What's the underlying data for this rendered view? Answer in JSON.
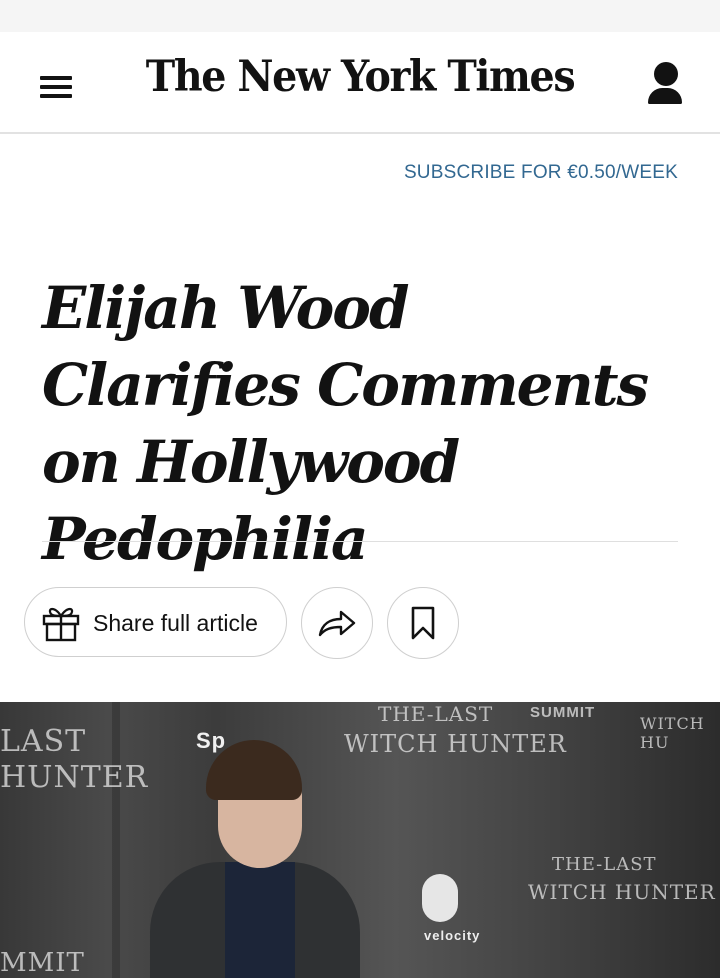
{
  "masthead": {
    "logo_text": "The New York Times",
    "menu_icon": "hamburger-menu-icon",
    "account_icon": "user-account-icon"
  },
  "subscribe": {
    "label": "SUBSCRIBE FOR €0.50/WEEK",
    "color": "#326891"
  },
  "article": {
    "headline": "Elijah Wood Clarifies Comments on Hollywood Pedophilia"
  },
  "actions": {
    "share_label": "Share full article",
    "share_icon": "gift-icon",
    "forward_icon": "share-arrow-icon",
    "bookmark_icon": "bookmark-icon"
  },
  "photo": {
    "backdrop_left_1": "LAST",
    "backdrop_left_2": "HUNTER",
    "backdrop_left_3": "MMIT",
    "backdrop_center_1": "THE-LAST",
    "backdrop_center_2": "WITCH HUNTER",
    "backdrop_summit": "SUMMIT",
    "backdrop_right": "WITCH HU",
    "backdrop_lower_1": "THE-LAST",
    "backdrop_lower_2": "WITCH HUNTER",
    "backdrop_spike": "Sp",
    "backdrop_velocity": "velocity"
  }
}
